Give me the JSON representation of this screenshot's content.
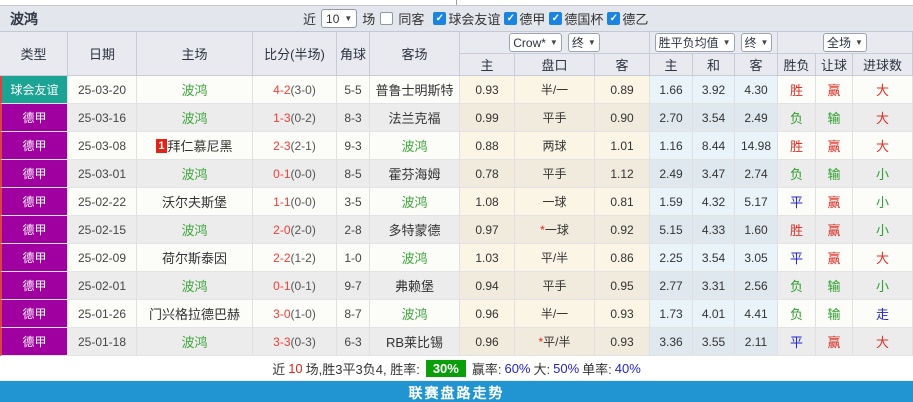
{
  "title": "波鸿",
  "toolbar": {
    "recent_label": "近",
    "matches_value": "10",
    "matches_label": "场",
    "same_opponent_label": "同客",
    "same_opponent_checked": false,
    "filters": [
      {
        "label": "球会友谊",
        "checked": true
      },
      {
        "label": "德甲",
        "checked": true
      },
      {
        "label": "德国杯",
        "checked": true
      },
      {
        "label": "德乙",
        "checked": true
      }
    ]
  },
  "header": {
    "left_cols": [
      "类型",
      "日期",
      "主场",
      "比分(半场)",
      "角球",
      "客场"
    ],
    "odds_company_select": "Crow*",
    "odds_final_select": "终",
    "mean_select": "胜平负均值",
    "mean_final_select": "终",
    "fullmatch_select": "全场",
    "sub_cols": [
      "主",
      "盘口",
      "客",
      "主",
      "和",
      "客",
      "胜负",
      "让球",
      "进球数"
    ]
  },
  "rows": [
    {
      "type": "球会友谊",
      "tc": "f",
      "date": "25-03-20",
      "home": "波鸿",
      "home_self": true,
      "badge": "",
      "score": "4-2",
      "half": "(3-0)",
      "corner": "5-5",
      "away": "普鲁士明斯特",
      "away_self": false,
      "o1": "0.93",
      "hc": "半/一",
      "star": false,
      "o2": "0.89",
      "m1": "1.66",
      "m2": "3.92",
      "m3": "4.30",
      "res": "胜",
      "res_c": "r",
      "hr": "赢",
      "hr_c": "r",
      "gl": "大",
      "gl_c": "r"
    },
    {
      "type": "德甲",
      "tc": "l",
      "date": "25-03-16",
      "home": "波鸿",
      "home_self": true,
      "badge": "",
      "score": "1-3",
      "half": "(0-2)",
      "corner": "8-3",
      "away": "法兰克福",
      "away_self": false,
      "o1": "0.99",
      "hc": "平手",
      "star": false,
      "o2": "0.90",
      "m1": "2.70",
      "m2": "3.54",
      "m3": "2.49",
      "res": "负",
      "res_c": "g",
      "hr": "输",
      "hr_c": "g",
      "gl": "大",
      "gl_c": "r"
    },
    {
      "type": "德甲",
      "tc": "l",
      "date": "25-03-08",
      "home": "拜仁慕尼黑",
      "home_self": false,
      "badge": "1",
      "score": "2-3",
      "half": "(2-1)",
      "corner": "9-3",
      "away": "波鸿",
      "away_self": true,
      "o1": "0.88",
      "hc": "两球",
      "star": false,
      "o2": "1.01",
      "m1": "1.16",
      "m2": "8.44",
      "m3": "14.98",
      "res": "胜",
      "res_c": "r",
      "hr": "赢",
      "hr_c": "r",
      "gl": "大",
      "gl_c": "r"
    },
    {
      "type": "德甲",
      "tc": "l",
      "date": "25-03-01",
      "home": "波鸿",
      "home_self": true,
      "badge": "",
      "score": "0-1",
      "half": "(0-0)",
      "corner": "8-5",
      "away": "霍芬海姆",
      "away_self": false,
      "o1": "0.78",
      "hc": "平手",
      "star": false,
      "o2": "1.12",
      "m1": "2.49",
      "m2": "3.47",
      "m3": "2.74",
      "res": "负",
      "res_c": "g",
      "hr": "输",
      "hr_c": "g",
      "gl": "小",
      "gl_c": "g"
    },
    {
      "type": "德甲",
      "tc": "l",
      "date": "25-02-22",
      "home": "沃尔夫斯堡",
      "home_self": false,
      "badge": "",
      "score": "1-1",
      "half": "(0-0)",
      "corner": "3-5",
      "away": "波鸿",
      "away_self": true,
      "o1": "1.08",
      "hc": "一球",
      "star": false,
      "o2": "0.81",
      "m1": "1.59",
      "m2": "4.32",
      "m3": "5.17",
      "res": "平",
      "res_c": "b",
      "hr": "赢",
      "hr_c": "r",
      "gl": "小",
      "gl_c": "g"
    },
    {
      "type": "德甲",
      "tc": "l",
      "date": "25-02-15",
      "home": "波鸿",
      "home_self": true,
      "badge": "",
      "score": "2-0",
      "half": "(2-0)",
      "corner": "2-8",
      "away": "多特蒙德",
      "away_self": false,
      "o1": "0.97",
      "hc": "一球",
      "star": true,
      "o2": "0.92",
      "m1": "5.15",
      "m2": "4.33",
      "m3": "1.60",
      "res": "胜",
      "res_c": "r",
      "hr": "赢",
      "hr_c": "r",
      "gl": "小",
      "gl_c": "g"
    },
    {
      "type": "德甲",
      "tc": "l",
      "date": "25-02-09",
      "home": "荷尔斯泰因",
      "home_self": false,
      "badge": "",
      "score": "2-2",
      "half": "(1-2)",
      "corner": "1-0",
      "away": "波鸿",
      "away_self": true,
      "o1": "1.03",
      "hc": "平/半",
      "star": false,
      "o2": "0.86",
      "m1": "2.25",
      "m2": "3.54",
      "m3": "3.05",
      "res": "平",
      "res_c": "b",
      "hr": "赢",
      "hr_c": "r",
      "gl": "大",
      "gl_c": "r"
    },
    {
      "type": "德甲",
      "tc": "l",
      "date": "25-02-01",
      "home": "波鸿",
      "home_self": true,
      "badge": "",
      "score": "0-1",
      "half": "(0-1)",
      "corner": "9-7",
      "away": "弗赖堡",
      "away_self": false,
      "o1": "0.94",
      "hc": "平手",
      "star": false,
      "o2": "0.95",
      "m1": "2.77",
      "m2": "3.31",
      "m3": "2.56",
      "res": "负",
      "res_c": "g",
      "hr": "输",
      "hr_c": "g",
      "gl": "小",
      "gl_c": "g"
    },
    {
      "type": "德甲",
      "tc": "l",
      "date": "25-01-26",
      "home": "门兴格拉德巴赫",
      "home_self": false,
      "badge": "",
      "score": "3-0",
      "half": "(1-0)",
      "corner": "8-7",
      "away": "波鸿",
      "away_self": true,
      "o1": "0.96",
      "hc": "半/一",
      "star": false,
      "o2": "0.93",
      "m1": "1.73",
      "m2": "4.01",
      "m3": "4.41",
      "res": "负",
      "res_c": "g",
      "hr": "输",
      "hr_c": "g",
      "gl": "走",
      "gl_c": "b"
    },
    {
      "type": "德甲",
      "tc": "l",
      "date": "25-01-18",
      "home": "波鸿",
      "home_self": true,
      "badge": "",
      "score": "3-3",
      "half": "(0-3)",
      "corner": "6-3",
      "away": "RB莱比锡",
      "away_self": false,
      "o1": "0.96",
      "hc": "平/半",
      "star": true,
      "o2": "0.93",
      "m1": "3.36",
      "m2": "3.55",
      "m3": "2.11",
      "res": "平",
      "res_c": "b",
      "hr": "赢",
      "hr_c": "r",
      "gl": "大",
      "gl_c": "r"
    }
  ],
  "summary": {
    "recent_label": "近",
    "recent_count": "10",
    "record_text": "场,胜3平3负4, 胜率:",
    "win_rate": "30%",
    "stats": [
      {
        "label": "赢率:",
        "value": "60%"
      },
      {
        "label": "大:",
        "value": "50%"
      },
      {
        "label": "单率:",
        "value": "40%"
      }
    ]
  },
  "footer": {
    "label": "联赛盘路走势"
  },
  "colors": {
    "friendly_type_bg": "#1ba393",
    "league_type_bg": "#a100a1",
    "win_red": "#dd2f25",
    "draw_blue": "#2323cc",
    "lose_green": "#2e9e2e",
    "self_team_green": "#3fa63f",
    "score_red": "#f23d38",
    "checkbox_blue": "#1a84e0",
    "win_rate_box_green": "#0a9e0a",
    "footer_bar_blue": "#2095d2"
  }
}
